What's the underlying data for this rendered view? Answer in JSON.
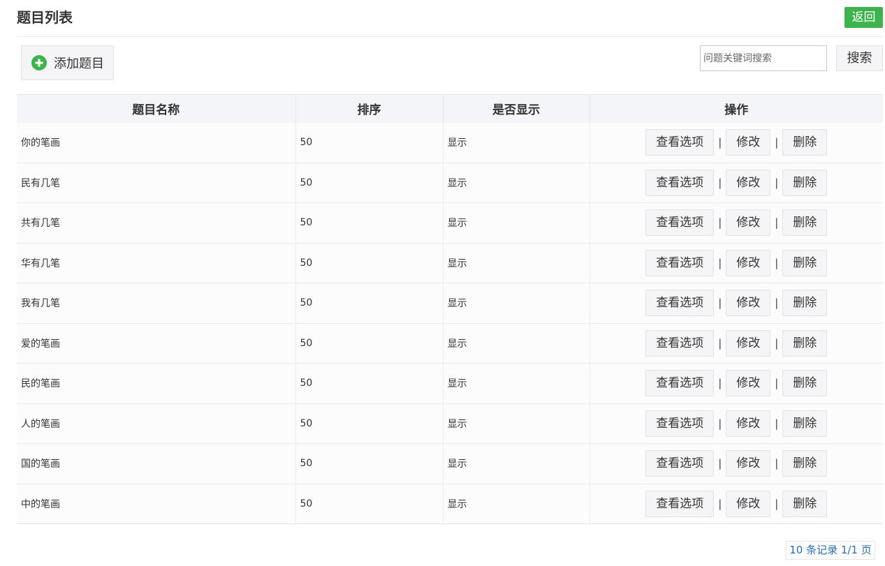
{
  "header": {
    "title": "题目列表",
    "back_label": "返回"
  },
  "toolbar": {
    "add_label": "添加题目",
    "search_placeholder": "问题关键词搜索",
    "search_label": "搜索"
  },
  "table": {
    "columns": [
      "题目名称",
      "排序",
      "是否显示",
      "操作"
    ],
    "actions": {
      "view": "查看选项",
      "edit": "修改",
      "delete": "删除",
      "separator": "|"
    },
    "rows": [
      {
        "name": "你的笔画",
        "order": "50",
        "display": "显示"
      },
      {
        "name": "民有几笔",
        "order": "50",
        "display": "显示"
      },
      {
        "name": "共有几笔",
        "order": "50",
        "display": "显示"
      },
      {
        "name": "华有几笔",
        "order": "50",
        "display": "显示"
      },
      {
        "name": "我有几笔",
        "order": "50",
        "display": "显示"
      },
      {
        "name": "爱的笔画",
        "order": "50",
        "display": "显示"
      },
      {
        "name": "民的笔画",
        "order": "50",
        "display": "显示"
      },
      {
        "name": "人的笔画",
        "order": "50",
        "display": "显示"
      },
      {
        "name": "国的笔画",
        "order": "50",
        "display": "显示"
      },
      {
        "name": "中的笔画",
        "order": "50",
        "display": "显示"
      }
    ]
  },
  "pager": {
    "summary": "10 条记录 1/1 页"
  },
  "colors": {
    "accent_green": "#3cb44b",
    "link_blue": "#2a6cb0"
  },
  "icons": {
    "add": "plus-circle-icon"
  }
}
